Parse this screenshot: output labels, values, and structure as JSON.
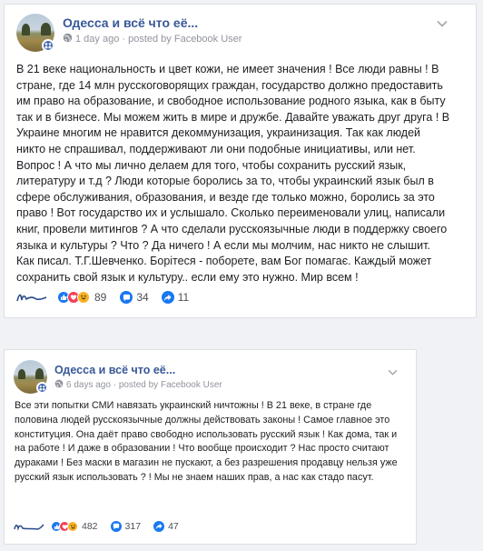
{
  "posts": [
    {
      "page_name": "Одесса и всё что её...",
      "meta": "1 day ago · posted by Facebook User",
      "text": "В 21 веке национальность и цвет кожи, не имеет значения ! Все люди равны ! В стране, где 14 млн русскоговорящих граждан, государство должно предоставить им право на образование, и свободное использование родного языка, как в быту так и в бизнесе. Мы можем жить в мире и дружбе. Давайте уважать друг друга ! В Украине многим не нравится декоммунизация, украинизация. Так как людей никто не спрашивал, поддерживают ли они подобные инициативы, или нет. Вопрос ! А что мы лично делаем для того, чтобы сохранить русский язык, литературу и т.д ? Люди которые боролись за то, чтобы украинский язык был в сфере обслуживания, образования, и везде где только можно, боролись за это право ! Вот государство их и услышало. Сколько переименовали улиц, написали книг, провели митингов ? А что сделали русскоязычные люди в поддержку своего языка и культуры ? Что ? Да ничего ! А если мы молчим, нас никто не слышит. Как писал. Т.Г.Шевченко. Борітеся - поборете, вам Бог помагає. Каждый может сохранить свой язык и культуру.. если ему это нужно. Мир всем !",
      "reactions_count": "89",
      "comments_count": "34",
      "shares_count": "11"
    },
    {
      "page_name": "Одесса и всё что её...",
      "meta": "6 days ago · posted by Facebook User",
      "text": "Все эти попытки СМИ навязать украинский ничтожны ! В 21 веке, в стране где половина людей русскоязычные должны действовать законы ! Самое главное это конституция. Она даёт право свободно использовать русский язык ! Как дома, так и на работе ! И даже в образовании ! Что вообще происходит ? Нас просто считают дураками ! Без маски в магазин не пускают, а без разрешения продавцу нельзя уже русский язык использовать ? ! Мы не знаем наших прав, а нас как стадо пасут.",
      "reactions_count": "482",
      "comments_count": "317",
      "shares_count": "47"
    }
  ],
  "colors": {
    "page_name": "#385898",
    "meta": "#90949c",
    "accent": "#1877f2",
    "signature": "#2a4a8a"
  },
  "icons": [
    "globe-icon",
    "chevron-down-icon",
    "like-reaction-icon",
    "love-reaction-icon",
    "haha-reaction-icon",
    "comment-icon",
    "share-icon",
    "group-badge-icon"
  ]
}
